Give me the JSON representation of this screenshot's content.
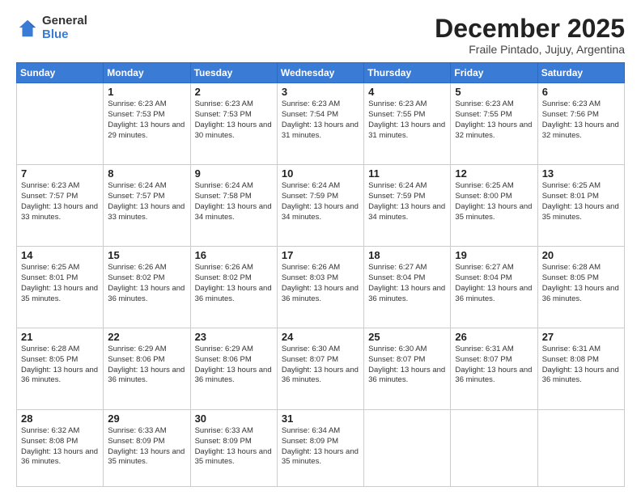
{
  "logo": {
    "general": "General",
    "blue": "Blue"
  },
  "header": {
    "month": "December 2025",
    "location": "Fraile Pintado, Jujuy, Argentina"
  },
  "weekdays": [
    "Sunday",
    "Monday",
    "Tuesday",
    "Wednesday",
    "Thursday",
    "Friday",
    "Saturday"
  ],
  "weeks": [
    [
      {
        "day": "",
        "content": ""
      },
      {
        "day": "1",
        "content": "Sunrise: 6:23 AM\nSunset: 7:53 PM\nDaylight: 13 hours\nand 29 minutes."
      },
      {
        "day": "2",
        "content": "Sunrise: 6:23 AM\nSunset: 7:53 PM\nDaylight: 13 hours\nand 30 minutes."
      },
      {
        "day": "3",
        "content": "Sunrise: 6:23 AM\nSunset: 7:54 PM\nDaylight: 13 hours\nand 31 minutes."
      },
      {
        "day": "4",
        "content": "Sunrise: 6:23 AM\nSunset: 7:55 PM\nDaylight: 13 hours\nand 31 minutes."
      },
      {
        "day": "5",
        "content": "Sunrise: 6:23 AM\nSunset: 7:55 PM\nDaylight: 13 hours\nand 32 minutes."
      },
      {
        "day": "6",
        "content": "Sunrise: 6:23 AM\nSunset: 7:56 PM\nDaylight: 13 hours\nand 32 minutes."
      }
    ],
    [
      {
        "day": "7",
        "content": "Sunrise: 6:23 AM\nSunset: 7:57 PM\nDaylight: 13 hours\nand 33 minutes."
      },
      {
        "day": "8",
        "content": "Sunrise: 6:24 AM\nSunset: 7:57 PM\nDaylight: 13 hours\nand 33 minutes."
      },
      {
        "day": "9",
        "content": "Sunrise: 6:24 AM\nSunset: 7:58 PM\nDaylight: 13 hours\nand 34 minutes."
      },
      {
        "day": "10",
        "content": "Sunrise: 6:24 AM\nSunset: 7:59 PM\nDaylight: 13 hours\nand 34 minutes."
      },
      {
        "day": "11",
        "content": "Sunrise: 6:24 AM\nSunset: 7:59 PM\nDaylight: 13 hours\nand 34 minutes."
      },
      {
        "day": "12",
        "content": "Sunrise: 6:25 AM\nSunset: 8:00 PM\nDaylight: 13 hours\nand 35 minutes."
      },
      {
        "day": "13",
        "content": "Sunrise: 6:25 AM\nSunset: 8:01 PM\nDaylight: 13 hours\nand 35 minutes."
      }
    ],
    [
      {
        "day": "14",
        "content": "Sunrise: 6:25 AM\nSunset: 8:01 PM\nDaylight: 13 hours\nand 35 minutes."
      },
      {
        "day": "15",
        "content": "Sunrise: 6:26 AM\nSunset: 8:02 PM\nDaylight: 13 hours\nand 36 minutes."
      },
      {
        "day": "16",
        "content": "Sunrise: 6:26 AM\nSunset: 8:02 PM\nDaylight: 13 hours\nand 36 minutes."
      },
      {
        "day": "17",
        "content": "Sunrise: 6:26 AM\nSunset: 8:03 PM\nDaylight: 13 hours\nand 36 minutes."
      },
      {
        "day": "18",
        "content": "Sunrise: 6:27 AM\nSunset: 8:04 PM\nDaylight: 13 hours\nand 36 minutes."
      },
      {
        "day": "19",
        "content": "Sunrise: 6:27 AM\nSunset: 8:04 PM\nDaylight: 13 hours\nand 36 minutes."
      },
      {
        "day": "20",
        "content": "Sunrise: 6:28 AM\nSunset: 8:05 PM\nDaylight: 13 hours\nand 36 minutes."
      }
    ],
    [
      {
        "day": "21",
        "content": "Sunrise: 6:28 AM\nSunset: 8:05 PM\nDaylight: 13 hours\nand 36 minutes."
      },
      {
        "day": "22",
        "content": "Sunrise: 6:29 AM\nSunset: 8:06 PM\nDaylight: 13 hours\nand 36 minutes."
      },
      {
        "day": "23",
        "content": "Sunrise: 6:29 AM\nSunset: 8:06 PM\nDaylight: 13 hours\nand 36 minutes."
      },
      {
        "day": "24",
        "content": "Sunrise: 6:30 AM\nSunset: 8:07 PM\nDaylight: 13 hours\nand 36 minutes."
      },
      {
        "day": "25",
        "content": "Sunrise: 6:30 AM\nSunset: 8:07 PM\nDaylight: 13 hours\nand 36 minutes."
      },
      {
        "day": "26",
        "content": "Sunrise: 6:31 AM\nSunset: 8:07 PM\nDaylight: 13 hours\nand 36 minutes."
      },
      {
        "day": "27",
        "content": "Sunrise: 6:31 AM\nSunset: 8:08 PM\nDaylight: 13 hours\nand 36 minutes."
      }
    ],
    [
      {
        "day": "28",
        "content": "Sunrise: 6:32 AM\nSunset: 8:08 PM\nDaylight: 13 hours\nand 36 minutes."
      },
      {
        "day": "29",
        "content": "Sunrise: 6:33 AM\nSunset: 8:09 PM\nDaylight: 13 hours\nand 35 minutes."
      },
      {
        "day": "30",
        "content": "Sunrise: 6:33 AM\nSunset: 8:09 PM\nDaylight: 13 hours\nand 35 minutes."
      },
      {
        "day": "31",
        "content": "Sunrise: 6:34 AM\nSunset: 8:09 PM\nDaylight: 13 hours\nand 35 minutes."
      },
      {
        "day": "",
        "content": ""
      },
      {
        "day": "",
        "content": ""
      },
      {
        "day": "",
        "content": ""
      }
    ]
  ]
}
